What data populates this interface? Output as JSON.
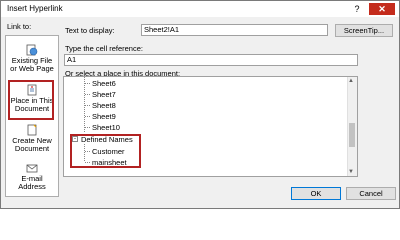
{
  "window": {
    "title": "Insert Hyperlink",
    "help": "?",
    "close": "✕"
  },
  "link_to": {
    "label": "Link to:",
    "items": [
      {
        "label": "Existing File or Web Page",
        "icon": "globe-file-icon"
      },
      {
        "label": "Place in This Document",
        "icon": "document-place-icon"
      },
      {
        "label": "Create New Document",
        "icon": "new-document-icon"
      },
      {
        "label": "E-mail Address",
        "icon": "email-icon"
      }
    ]
  },
  "text_to_display": {
    "label": "Text to display:",
    "value": "Sheet2!A1"
  },
  "screentip_button": "ScreenTip...",
  "cell_reference": {
    "label": "Type the cell reference:",
    "value": "A1"
  },
  "place_label": "Or select a place in this document:",
  "tree": {
    "sheets": [
      "Sheet6",
      "Sheet7",
      "Sheet8",
      "Sheet9",
      "Sheet10"
    ],
    "defined_names_label": "Defined Names",
    "defined_names": [
      "Customer",
      "mainsheet"
    ]
  },
  "ok_button": "OK",
  "cancel_button": "Cancel",
  "colors": {
    "highlight_border": "#b22222",
    "close_button": "#c42b1c",
    "selected_bg": "#cce4f7"
  }
}
